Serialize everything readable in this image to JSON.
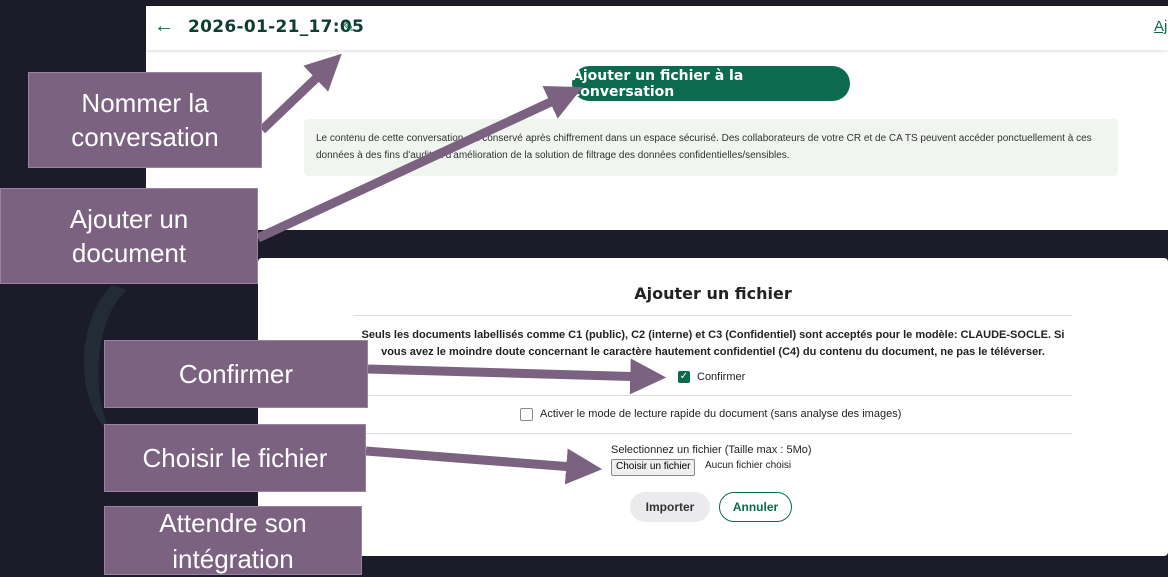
{
  "top": {
    "title": "2026-01-21_17:05",
    "back_icon": "arrow-left-icon",
    "edit_icon": "pencil-icon",
    "right_link": "Aj",
    "add_file_button": "Ajouter un fichier à la conversation",
    "info_text": "Le contenu de cette conversation est conservé après chiffrement dans un espace sécurisé. Des collaborateurs de votre CR et de CA TS peuvent accéder ponctuellement à ces données à des fins d'audit et d'amélioration de la solution de filtrage des données confidentielles/sensibles."
  },
  "dialog": {
    "title": "Ajouter un fichier",
    "warning": "Seuls les documents labellisés comme C1 (public), C2 (interne) et C3 (Confidentiel) sont acceptés pour le modèle: CLAUDE-SOCLE. Si vous avez le moindre doute concernant le caractère hautement confidentiel (C4) du contenu du document, ne pas le téléverser.",
    "confirm_label": "Confirmer",
    "confirm_checked": true,
    "fast_read_label": "Activer le mode de lecture rapide du document (sans analyse des images)",
    "fast_read_checked": false,
    "select_label": "Selectionnez un fichier (Taille max : 5Mo)",
    "choose_button": "Choisir un fichier",
    "no_file": "Aucun fichier choisi",
    "import_button": "Importer",
    "cancel_button": "Annuler"
  },
  "annotations": {
    "nommer_line1": "Nommer la",
    "nommer_line2": "conversation",
    "ajouter_line1": "Ajouter un",
    "ajouter_line2": "document",
    "confirmer": "Confirmer",
    "choisir": "Choisir le fichier",
    "attendre_line1": "Attendre son",
    "attendre_line2": "intégration"
  },
  "colors": {
    "brand_green": "#0c6b4e",
    "annotation_purple": "#7b6281",
    "arrow_purple": "#7b6281",
    "background": "#1c1b29"
  }
}
